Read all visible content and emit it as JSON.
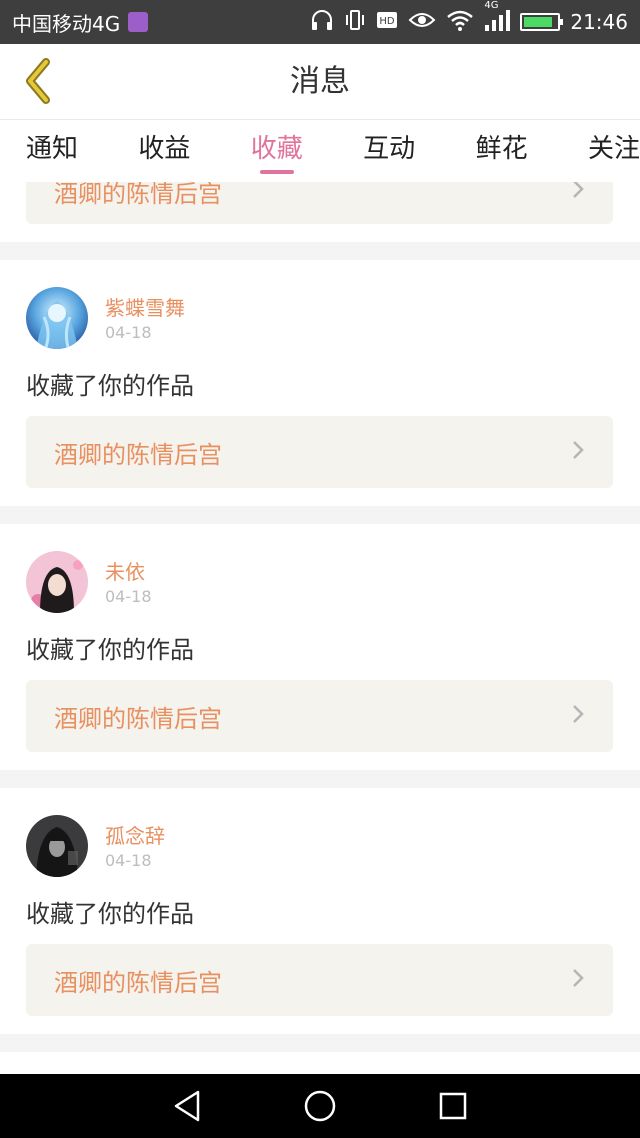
{
  "status_bar": {
    "carrier": "中国移动4G",
    "network": "4G",
    "time": "21:46",
    "battery_level": 0.85,
    "icons": [
      "headphones-icon",
      "vibrate-icon",
      "hd-icon",
      "eye-icon",
      "wifi-icon",
      "signal-icon",
      "battery-icon"
    ]
  },
  "header": {
    "title": "消息",
    "back_icon": "chevron-left-icon"
  },
  "tabs": [
    {
      "label": "通知",
      "active": false
    },
    {
      "label": "收益",
      "active": false
    },
    {
      "label": "收藏",
      "active": true
    },
    {
      "label": "互动",
      "active": false
    },
    {
      "label": "鲜花",
      "active": false
    },
    {
      "label": "关注",
      "active": false
    }
  ],
  "partial_item": {
    "work_title": "酒卿的陈情后宫"
  },
  "items": [
    {
      "user": "紫蝶雪舞",
      "date": "04-18",
      "message": "收藏了你的作品",
      "work_title": "酒卿的陈情后宫"
    },
    {
      "user": "未依",
      "date": "04-18",
      "message": "收藏了你的作品",
      "work_title": "酒卿的陈情后宫"
    },
    {
      "user": "孤念辞",
      "date": "04-18",
      "message": "收藏了你的作品",
      "work_title": "酒卿的陈情后宫"
    }
  ],
  "colors": {
    "accent": "#e0749c",
    "orange_text": "#e89060",
    "link_bg": "#f5f3ee",
    "back_icon": "#d8b830"
  }
}
